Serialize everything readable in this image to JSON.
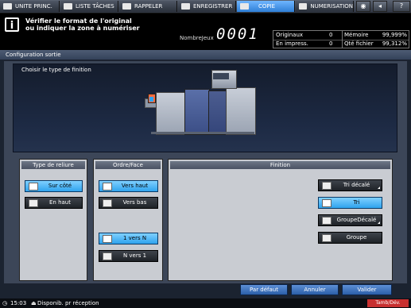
{
  "tabs": [
    {
      "label": "UNITE PRINC.",
      "icon": "main-unit-icon"
    },
    {
      "label": "LISTE TÂCHES",
      "icon": "job-list-icon"
    },
    {
      "label": "RAPPELER",
      "icon": "recall-icon"
    },
    {
      "label": "ENREGISTRER",
      "icon": "store-icon"
    },
    {
      "label": "COPIE",
      "icon": "copy-icon"
    },
    {
      "label": "NUMERISATION",
      "icon": "scan-icon"
    }
  ],
  "top_icons": {
    "help": "?"
  },
  "message": {
    "line1": "Vérifier le format de l'original",
    "line2": "ou indiquer la zone à numériser",
    "icon": "i"
  },
  "jobcount": {
    "label": "NombreJeux",
    "value": "0001"
  },
  "counters": {
    "originals_label": "Originaux",
    "originals_value": "0",
    "memory_label": "Mémoire",
    "memory_value": "99,999%",
    "printing_label": "En impress.",
    "printing_value": "0",
    "file_label": "Qté fichier",
    "file_value": "99,312%"
  },
  "section_title": "Configuration sortie",
  "image_title": "Choisir le type de finition",
  "groups": {
    "binding": {
      "title": "Type de reliure",
      "options": [
        {
          "label": "Sur côté",
          "selected": true
        },
        {
          "label": "En haut",
          "selected": false
        }
      ]
    },
    "order": {
      "title": "Ordre/Face",
      "options": [
        {
          "label": "Vers haut",
          "selected": true
        },
        {
          "label": "Vers bas",
          "selected": false
        },
        {
          "label": "1 vers N",
          "selected": true
        },
        {
          "label": "N vers 1",
          "selected": false
        }
      ]
    },
    "finish": {
      "title": "Finition",
      "options": [
        {
          "label": "Tri décalé",
          "selected": false
        },
        {
          "label": "Tri",
          "selected": true
        },
        {
          "label": "GroupeDécalé",
          "selected": false
        },
        {
          "label": "Groupe",
          "selected": false
        }
      ]
    }
  },
  "footer": {
    "default_label": "Par défaut",
    "cancel_label": "Annuler",
    "ok_label": "Valider"
  },
  "status": {
    "time": "15:03",
    "message": "Disponib. pr réception",
    "toner": "Tamb/Dév."
  },
  "colors": {
    "accent": "#2fa3ee",
    "tab_active": "#3a8ee6",
    "footer_button": "#3b6fb8",
    "toner_badge": "#c83030"
  }
}
